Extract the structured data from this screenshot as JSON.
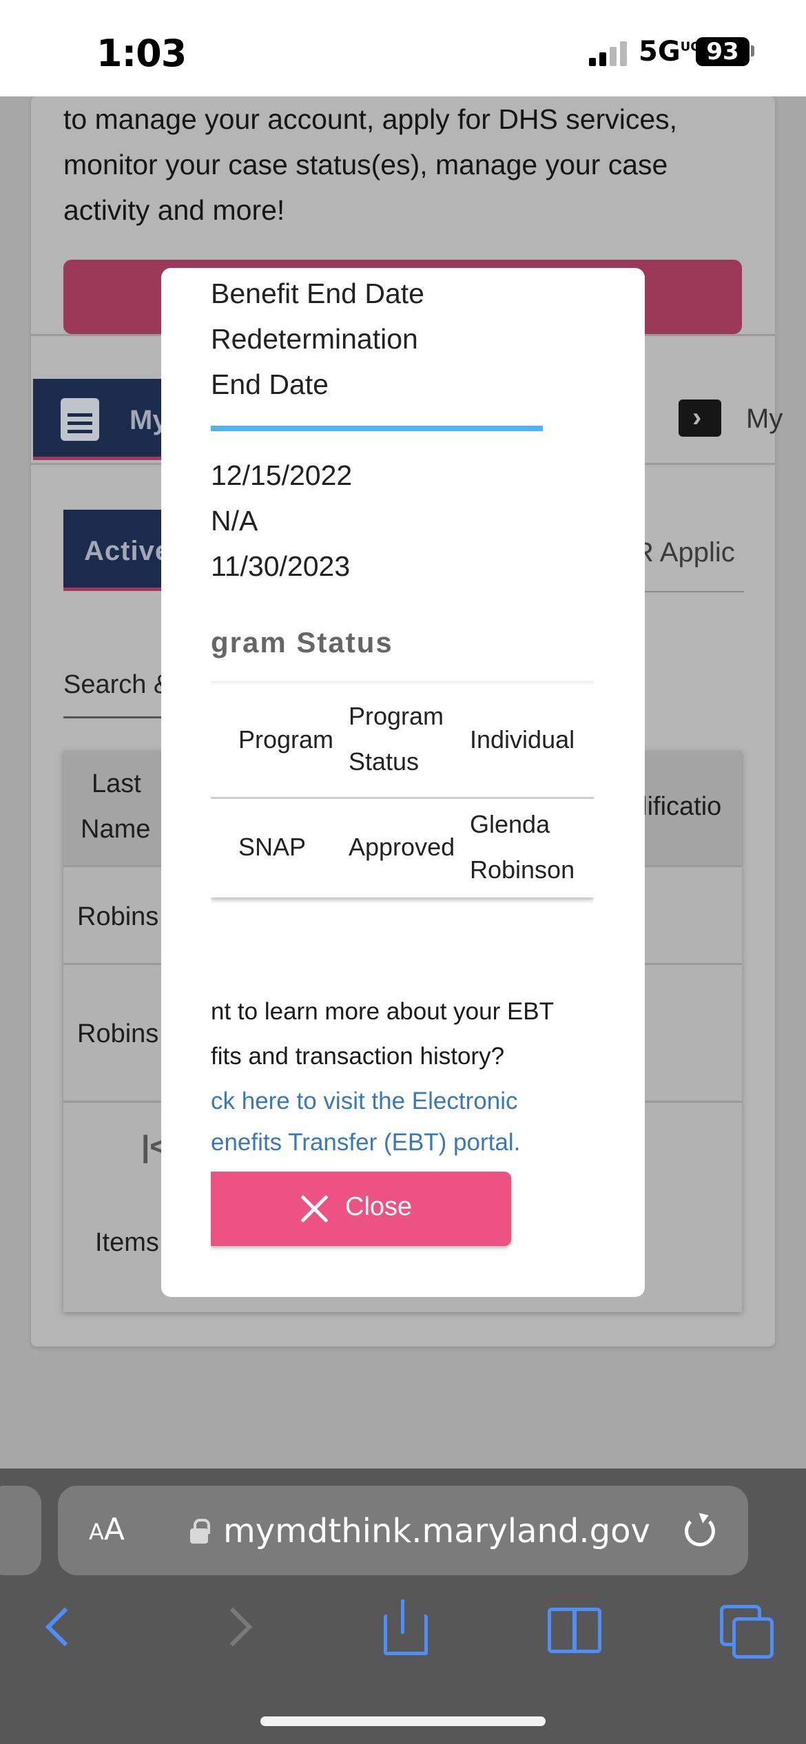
{
  "status_bar": {
    "time": "1:03",
    "network": "5G",
    "network_sup": "UC",
    "battery": "93"
  },
  "background_page": {
    "intro_text": "to manage your account, apply for DHS services, monitor your case status(es), manage your case activity and more!",
    "tab_my_cases": "My",
    "tab_my_applications": "My",
    "subtab_active": "Active",
    "subtab_r_applications": "R Applic",
    "search_label": "Search &",
    "table_header_last_name": "Last",
    "table_header_last_name2": "Name",
    "table_header_qualification": "alificatio",
    "rows": [
      "Robins",
      "Robins"
    ],
    "pager_first": "|<",
    "items_label": "Items"
  },
  "modal": {
    "labels": [
      "Benefit End Date",
      "Redetermination",
      "End Date"
    ],
    "values": [
      "12/15/2022",
      "N/A",
      "11/30/2023"
    ],
    "section_heading": "gram Status",
    "program_table": {
      "headers": [
        "Program",
        "Program Status",
        "Individual"
      ],
      "rows": [
        {
          "program": "SNAP",
          "status": "Approved",
          "individual": "Glenda Robinson"
        }
      ]
    },
    "ebt_question_line1": "nt to learn more about your EBT",
    "ebt_question_line2": "fits and transaction history?",
    "ebt_link_line1": "ck here to visit the Electronic",
    "ebt_link_line2": "enefits Transfer (EBT) portal.",
    "close_label": "Close"
  },
  "browser": {
    "text_size_label": "AA",
    "url": "mymdthink.maryland.gov"
  },
  "colors": {
    "close_button": "#ec5383",
    "link": "#3a78b7",
    "divider_accent": "#4fb3ef",
    "safari_blue": "#4f8ef6"
  }
}
